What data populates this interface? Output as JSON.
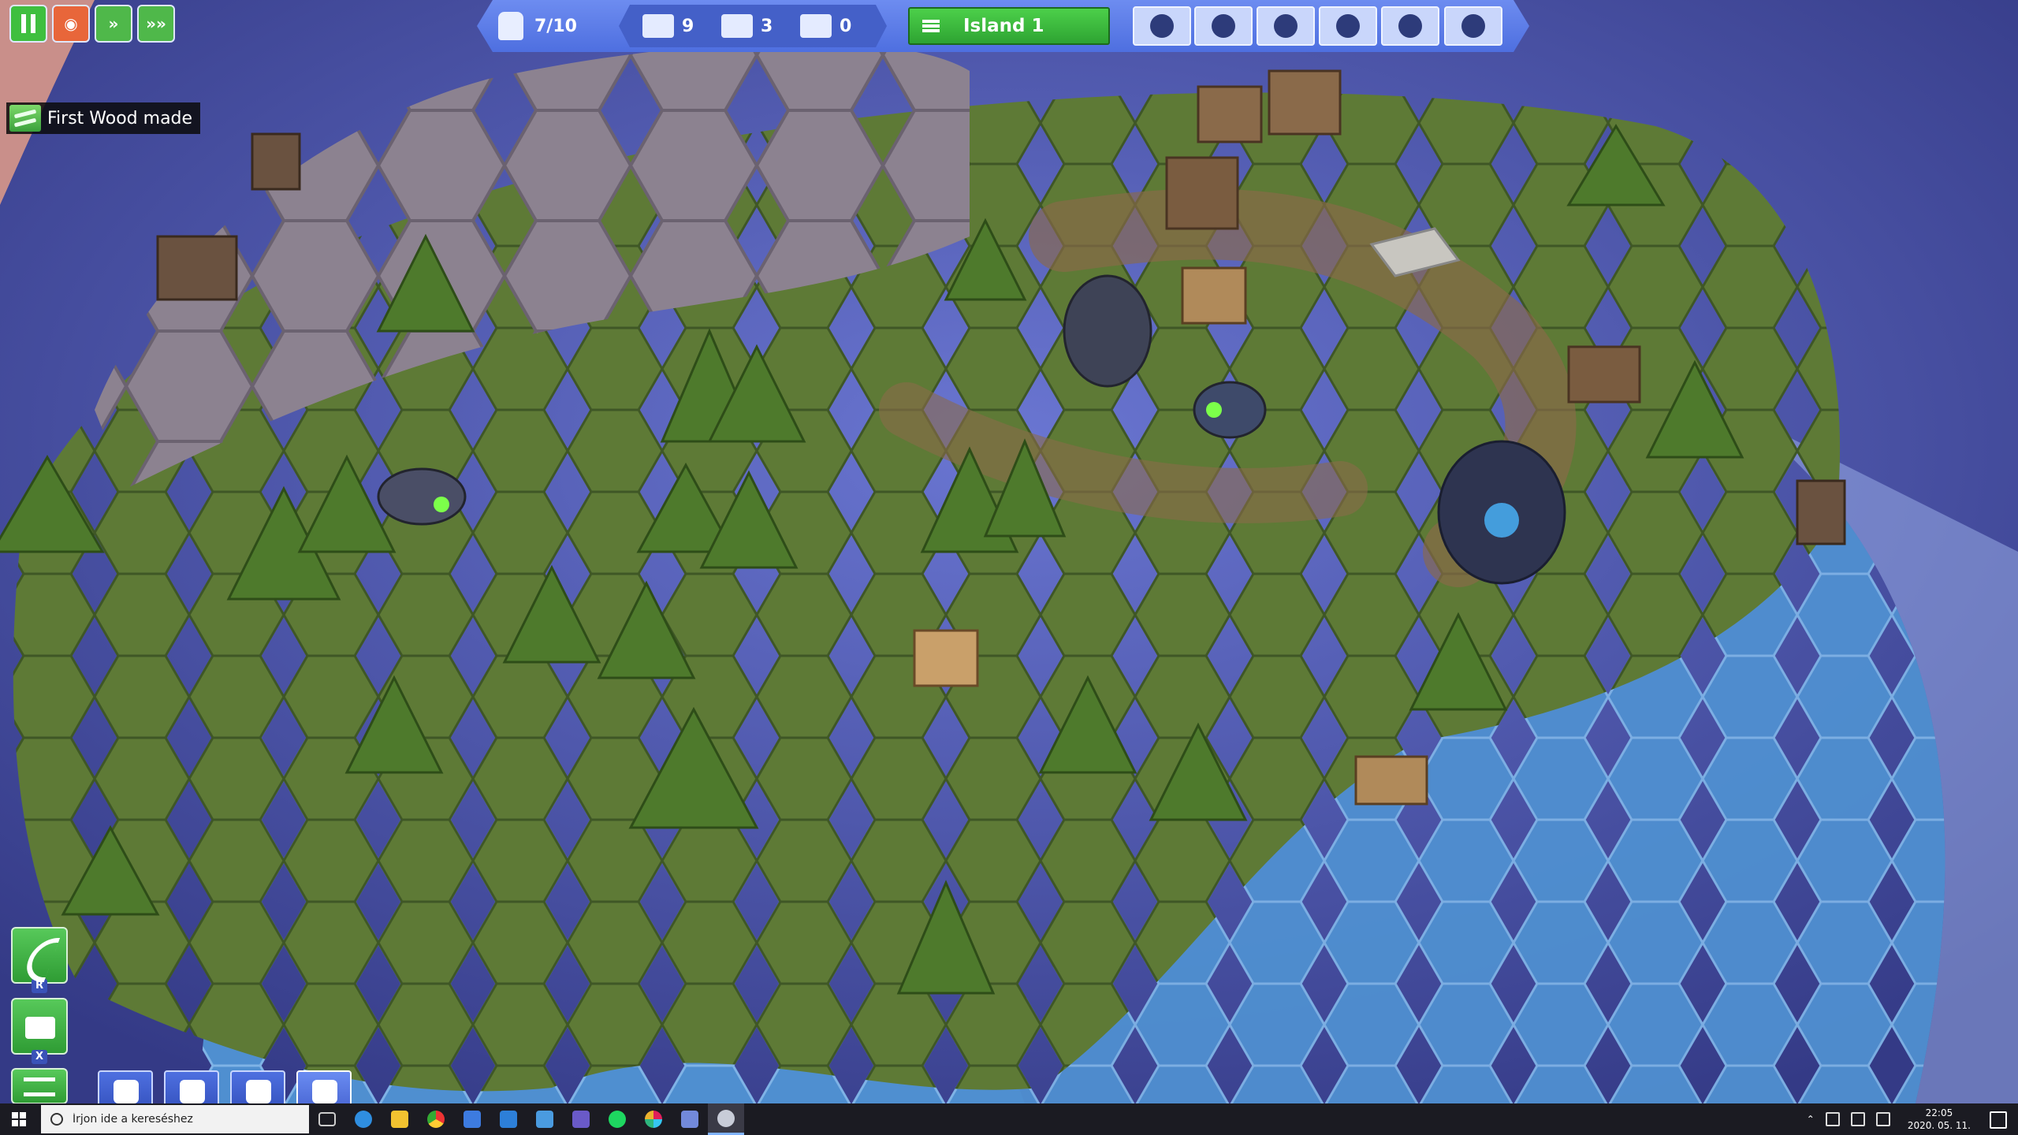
{
  "game": {
    "speed_controls": [
      {
        "name": "pause-button",
        "icon": "pause-icon"
      },
      {
        "name": "speed-1-button",
        "icon": "play-icon"
      },
      {
        "name": "speed-2-button",
        "icon": "fast-forward-icon"
      },
      {
        "name": "speed-3-button",
        "icon": "fastest-forward-icon"
      }
    ],
    "population": {
      "value": "7/10",
      "icon": "workers-icon"
    },
    "resources": [
      {
        "icon": "wood-planks-icon",
        "value": "9"
      },
      {
        "icon": "tools-icon",
        "value": "3"
      },
      {
        "icon": "stone-bricks-icon",
        "value": "0"
      }
    ],
    "island_button": {
      "label": "Island 1",
      "icon": "menu-icon"
    },
    "top_tools": [
      {
        "icon": "happiness-icon"
      },
      {
        "icon": "food-icon"
      },
      {
        "icon": "workers-manage-icon"
      },
      {
        "icon": "settings-icon"
      },
      {
        "icon": "research-icon"
      },
      {
        "icon": "transport-icon"
      }
    ],
    "notification": {
      "text": "First Wood made",
      "icon": "wood-icon"
    },
    "side_tools": [
      {
        "icon": "road-icon",
        "key": "R"
      },
      {
        "icon": "bulldozer-icon",
        "key": "X"
      },
      {
        "icon": "menu-icon"
      }
    ],
    "build_categories": [
      {
        "icon": "housing-icon"
      },
      {
        "icon": "food-production-icon"
      },
      {
        "icon": "science-icon"
      },
      {
        "icon": "industry-icon"
      }
    ]
  },
  "taskbar": {
    "search_placeholder": "Írjon ide a kereséshez",
    "apps": [
      "task-view-icon",
      "edge-icon",
      "file-explorer-icon",
      "chrome-icon",
      "store-icon",
      "mail-icon",
      "app-icon",
      "save-icon",
      "spotify-icon",
      "slack-icon",
      "discord-icon",
      "game-icon"
    ],
    "time": "22:05",
    "date": "2020. 05. 11."
  },
  "colors": {
    "hud_blue": "#5b7ce6",
    "accent_green": "#3fbf3f",
    "water": "#4a86c8",
    "grass": "#5b7a3a"
  }
}
